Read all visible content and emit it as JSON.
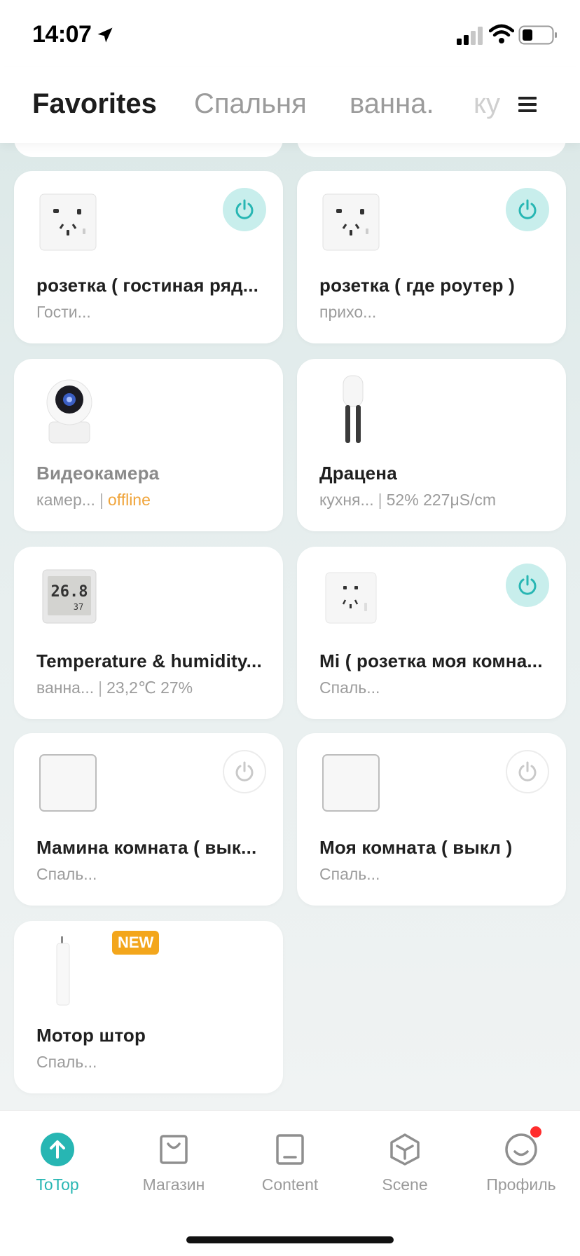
{
  "status_bar": {
    "time": "14:07"
  },
  "tabs": [
    {
      "label": "Favorites",
      "active": true
    },
    {
      "label": "Спальня"
    },
    {
      "label": "ванна."
    },
    {
      "label": "ку"
    }
  ],
  "devices": [
    {
      "name": "розетка ( гостиная ряд...",
      "room": "Гости...",
      "type": "socket",
      "power": "on"
    },
    {
      "name": "розетка ( где роутер )",
      "room": "прихо...",
      "type": "socket",
      "power": "on"
    },
    {
      "name": "Видеокамера",
      "room": "камер...",
      "status": "offline",
      "type": "camera",
      "dim": true
    },
    {
      "name": "Драцена",
      "room": "кухня...",
      "status": "52% 227μS/cm",
      "type": "plant-sensor"
    },
    {
      "name": "Temperature & humidity...",
      "room": "ванна...",
      "status": "23,2℃ 27%",
      "type": "thermometer",
      "display": [
        "26.8",
        "37"
      ]
    },
    {
      "name": "Mi ( розетка моя комна...",
      "room": "Спаль...",
      "type": "socket-small",
      "power": "on"
    },
    {
      "name": "Мамина  комната ( вык...",
      "room": "Спаль...",
      "type": "switch",
      "power": "off"
    },
    {
      "name": "Моя комната ( выкл )",
      "room": "Спаль...",
      "type": "switch",
      "power": "off"
    },
    {
      "name": "Мотор штор",
      "room": "Спаль...",
      "type": "curtain-motor",
      "badge": "NEW"
    }
  ],
  "bottom_nav": [
    {
      "label": "ToTop",
      "icon": "arrow-up-icon",
      "active": true
    },
    {
      "label": "Магазин",
      "icon": "shopping-bag-icon"
    },
    {
      "label": "Content",
      "icon": "tablet-icon"
    },
    {
      "label": "Scene",
      "icon": "cube-icon"
    },
    {
      "label": "Профиль",
      "icon": "smiley-icon",
      "notification": true
    }
  ],
  "colors": {
    "accent": "#27b6b3",
    "power_on_bg": "#c8eeec",
    "offline": "#f0a43a",
    "badge": "#f3a61c"
  }
}
